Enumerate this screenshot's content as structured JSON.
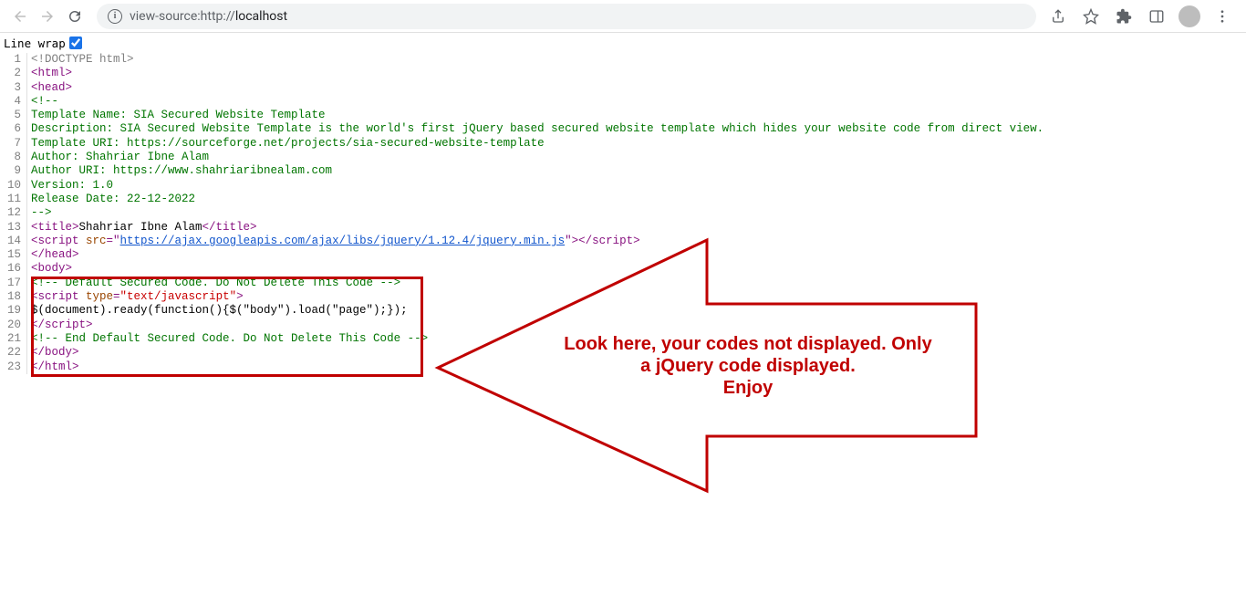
{
  "toolbar": {
    "url_prefix": "view-source:http://",
    "url_host": "localhost"
  },
  "linewrap": {
    "label": "Line wrap",
    "checked": true
  },
  "source": {
    "lines": [
      {
        "n": 1,
        "segments": [
          {
            "cls": "c-gray",
            "t": "<!DOCTYPE html>"
          }
        ]
      },
      {
        "n": 2,
        "segments": [
          {
            "cls": "c-purple",
            "t": "<html>"
          }
        ]
      },
      {
        "n": 3,
        "segments": [
          {
            "cls": "c-purple",
            "t": "<head>"
          }
        ]
      },
      {
        "n": 4,
        "segments": [
          {
            "cls": "c-green",
            "t": "<!--"
          }
        ]
      },
      {
        "n": 5,
        "segments": [
          {
            "cls": "c-green",
            "t": "Template Name: SIA Secured Website Template"
          }
        ]
      },
      {
        "n": 6,
        "segments": [
          {
            "cls": "c-green",
            "t": "Description: SIA Secured Website Template is the world's first jQuery based secured website template which hides your website code from direct view."
          }
        ]
      },
      {
        "n": 7,
        "segments": [
          {
            "cls": "c-green",
            "t": "Template URI: https://sourceforge.net/projects/sia-secured-website-template"
          }
        ]
      },
      {
        "n": 8,
        "segments": [
          {
            "cls": "c-green",
            "t": "Author: Shahriar Ibne Alam"
          }
        ]
      },
      {
        "n": 9,
        "segments": [
          {
            "cls": "c-green",
            "t": "Author URI: https://www.shahriaribnealam.com"
          }
        ]
      },
      {
        "n": 10,
        "segments": [
          {
            "cls": "c-green",
            "t": "Version: 1.0"
          }
        ]
      },
      {
        "n": 11,
        "segments": [
          {
            "cls": "c-green",
            "t": "Release Date: 22-12-2022"
          }
        ]
      },
      {
        "n": 12,
        "segments": [
          {
            "cls": "c-green",
            "t": "-->"
          }
        ]
      },
      {
        "n": 13,
        "segments": [
          {
            "cls": "c-purple",
            "t": "<title>"
          },
          {
            "cls": "c-black",
            "t": "Shahriar Ibne Alam"
          },
          {
            "cls": "c-purple",
            "t": "</title>"
          }
        ]
      },
      {
        "n": 14,
        "segments": [
          {
            "cls": "c-purple",
            "t": "<script "
          },
          {
            "cls": "c-brown",
            "t": "src"
          },
          {
            "cls": "c-purple",
            "t": "=\""
          },
          {
            "cls": "c-blue",
            "t": "https://ajax.googleapis.com/ajax/libs/jquery/1.12.4/jquery.min.js"
          },
          {
            "cls": "c-purple",
            "t": "\"></script>"
          }
        ]
      },
      {
        "n": 15,
        "segments": [
          {
            "cls": "c-purple",
            "t": "</head>"
          }
        ]
      },
      {
        "n": 16,
        "segments": [
          {
            "cls": "c-purple",
            "t": "<body>"
          }
        ]
      },
      {
        "n": 17,
        "segments": [
          {
            "cls": "c-green",
            "t": "<!-- Default Secured Code. Do Not Delete This Code -->"
          }
        ]
      },
      {
        "n": 18,
        "segments": [
          {
            "cls": "c-purple",
            "t": "<script "
          },
          {
            "cls": "c-brown",
            "t": "type"
          },
          {
            "cls": "c-purple",
            "t": "="
          },
          {
            "cls": "c-red",
            "t": "\"text/javascript\""
          },
          {
            "cls": "c-purple",
            "t": ">"
          }
        ]
      },
      {
        "n": 19,
        "segments": [
          {
            "cls": "c-black",
            "t": "$(document).ready(function(){$(\"body\").load(\"page\");});"
          }
        ]
      },
      {
        "n": 20,
        "segments": [
          {
            "cls": "c-purple",
            "t": "</script>"
          }
        ]
      },
      {
        "n": 21,
        "segments": [
          {
            "cls": "c-green",
            "t": "<!-- End Default Secured Code. Do Not Delete This Code -->"
          }
        ]
      },
      {
        "n": 22,
        "segments": [
          {
            "cls": "c-purple",
            "t": "</body>"
          }
        ]
      },
      {
        "n": 23,
        "segments": [
          {
            "cls": "c-purple",
            "t": "</html>"
          }
        ]
      }
    ]
  },
  "callout": {
    "line1": "Look here, your codes not displayed. Only",
    "line2": "a jQuery code displayed.",
    "line3": "Enjoy"
  }
}
